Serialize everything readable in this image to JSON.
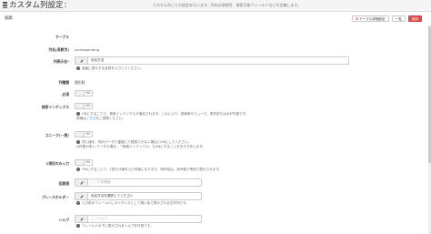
{
  "header": {
    "title": "カスタム列設定",
    "colon": ":",
    "info": "カスタム列ごとの設定を行います。列の必須項目、検索可能フィールドなどを定義します。"
  },
  "toolbar": {
    "table_settings": "テーブル詳細設定",
    "list": "一覧",
    "save": "保存"
  },
  "section": {
    "title": "編集"
  },
  "fields": {
    "table": {
      "label": "テーブル",
      "value": ""
    },
    "column_name": {
      "label": "列名(英数字)",
      "value": "corresponding"
    },
    "display_name": {
      "label": "列表示名*",
      "value": "対応方法",
      "help": "画面に表示する名称を入力してください。"
    },
    "column_type": {
      "label": "列種類",
      "value": "選択肢"
    },
    "required": {
      "label": "必須",
      "state": "NO"
    },
    "search_index": {
      "label": "検索インデックス",
      "state": "NO",
      "help1": "ONにすることで、検索インデックスが追加されます。これにより、検索時やビューで、条件絞り込みが可能です。",
      "help2_prefix": "詳細は",
      "help2_link": "こちら",
      "help2_suffix": "をご参照ください。"
    },
    "unique": {
      "label": "ユニーク(一意)",
      "state": "NO",
      "help1": "同じ値を、他のデータで重複して登録させない場合にONにしてください。",
      "help2": "※件数が多い データの場合、「検索インデックス」もONにすることをおすすめします。"
    },
    "single_input": {
      "label": "1項目のみ入力",
      "state": "NO",
      "help": "ONにすることで、1回だけ値を入力可能になります。再作成は、読み取り専用で表示されます。"
    },
    "default_value": {
      "label": "初期値",
      "placeholder": "ここの初期値"
    },
    "placeholder": {
      "label": "プレースホルダー",
      "value": "対応方法を選択してください",
      "help": "入力前のフィールドにガイダンスとして薄い色で表示される文字列です。"
    },
    "help_text": {
      "label": "ヘルプ",
      "placeholder": "ここヘルプ",
      "help": "フィールドの下に表示されるヘルプを作成です。"
    }
  }
}
